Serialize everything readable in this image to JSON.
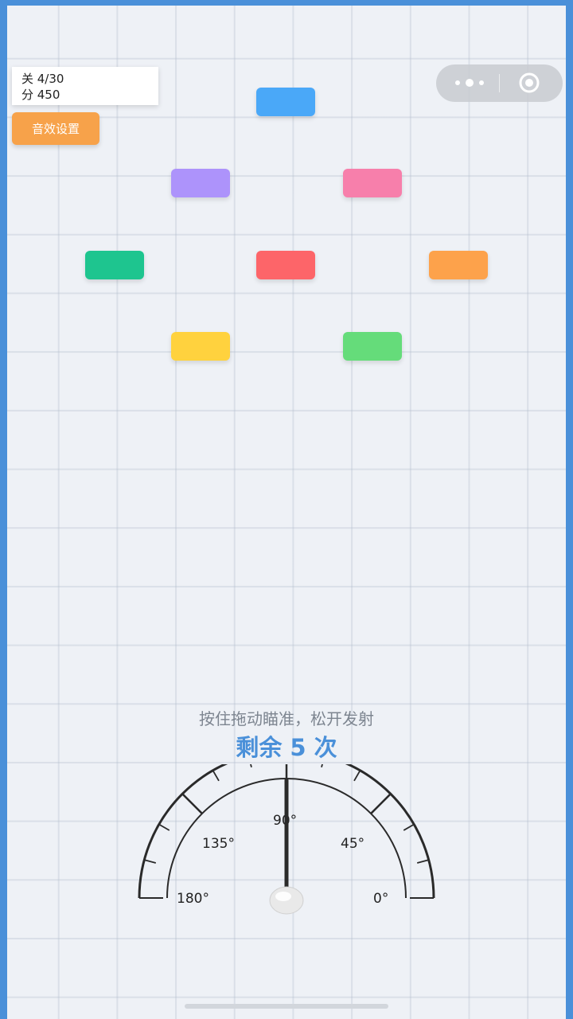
{
  "hud": {
    "level_label": "关 4/30",
    "score_label": "分 450"
  },
  "buttons": {
    "sound_settings": "音效设置"
  },
  "blocks": [
    {
      "id": "block-blue",
      "color": "#4aa8f8"
    },
    {
      "id": "block-purple",
      "color": "#ad93fb"
    },
    {
      "id": "block-pink",
      "color": "#f77fab"
    },
    {
      "id": "block-teal",
      "color": "#1ec58f"
    },
    {
      "id": "block-red",
      "color": "#fd6569"
    },
    {
      "id": "block-orange",
      "color": "#fda24b"
    },
    {
      "id": "block-yellow",
      "color": "#ffd23e"
    },
    {
      "id": "block-green",
      "color": "#65dc7a"
    }
  ],
  "instructions": {
    "hint": "按住拖动瞄准，松开发射",
    "remaining": "剩余 5 次"
  },
  "gauge": {
    "angle_labels": [
      "180°",
      "135°",
      "90°",
      "45°",
      "0°"
    ],
    "current_angle": 90
  },
  "colors": {
    "frame": "#4a90d9",
    "accent": "#4a90d9",
    "button": "#f7a24a"
  }
}
